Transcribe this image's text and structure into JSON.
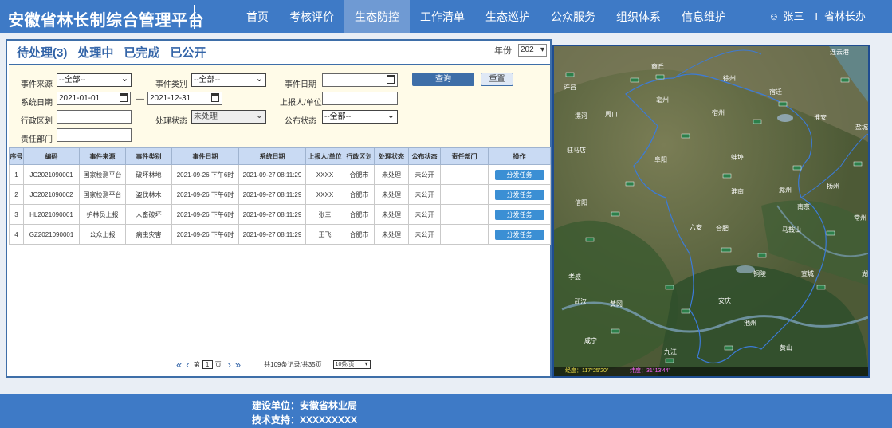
{
  "header": {
    "title": "安徽省林长制综合管理平台",
    "nav": [
      "首页",
      "考核评价",
      "生态防控",
      "工作清单",
      "生态巡护",
      "公众服务",
      "组织体系",
      "信息维护"
    ],
    "active_nav": "生态防控",
    "user": "张三",
    "role": "省林长办",
    "role_sep": "I"
  },
  "status_tabs": [
    "待处理(3)",
    "处理中",
    "已完成",
    "已公开"
  ],
  "year": {
    "label": "年份",
    "value": "202"
  },
  "filters": {
    "event_source_label": "事件来源",
    "event_source_value": "--全部--",
    "event_type_label": "事件类别",
    "event_type_value": "--全部--",
    "event_date_label": "事件日期",
    "event_date_value": "",
    "system_date_label": "系统日期",
    "system_date_start": "2021-01-01",
    "system_date_sep": "—",
    "system_date_end": "2021-12-31",
    "reporter_label": "上报人/单位",
    "reporter_value": "",
    "region_label": "行政区划",
    "region_value": "",
    "process_status_label": "处理状态",
    "process_status_value": "未处理",
    "publish_status_label": "公布状态",
    "publish_status_value": "--全部--",
    "dept_label": "责任部门",
    "dept_value": "",
    "query_button": "查询",
    "reset_button": "重置"
  },
  "table": {
    "columns": [
      "序号",
      "编码",
      "事件来源",
      "事件类别",
      "事件日期",
      "系统日期",
      "上报人/单位",
      "行政区划",
      "处理状态",
      "公布状态",
      "责任部门",
      "操作"
    ],
    "rows": [
      [
        "1",
        "JC2021090001",
        "国家检测平台",
        "破坏林地",
        "2021-09-26 下午6时",
        "2021-09-27 08:11:29",
        "XXXX",
        "合肥市",
        "未处理",
        "未公开",
        "",
        "分发任务"
      ],
      [
        "2",
        "JC2021090002",
        "国家检测平台",
        "盗伐林木",
        "2021-09-26 下午6时",
        "2021-09-27 08:11:29",
        "XXXX",
        "合肥市",
        "未处理",
        "未公开",
        "",
        "分发任务"
      ],
      [
        "3",
        "HL2021090001",
        "护林员上报",
        "人畜破坏",
        "2021-09-26 下午6时",
        "2021-09-27 08:11:29",
        "张三",
        "合肥市",
        "未处理",
        "未公开",
        "",
        "分发任务"
      ],
      [
        "4",
        "GZ2021090001",
        "公众上报",
        "病虫灾害",
        "2021-09-26 下午6时",
        "2021-09-27 08:11:29",
        "王飞",
        "合肥市",
        "未处理",
        "未公开",
        "",
        "分发任务"
      ]
    ]
  },
  "pager": {
    "page_prefix": "第",
    "page": "1",
    "page_suffix": "页",
    "info": "共109条记录/共35页",
    "page_size": "10条/页"
  },
  "map": {
    "cities": [
      "连云港",
      "商丘",
      "徐州",
      "宿迁",
      "淮安",
      "亳州",
      "宿州",
      "周口",
      "许昌",
      "漯河",
      "盐城",
      "蚌埠",
      "驻马店",
      "阜阳",
      "滁州",
      "扬州",
      "淮南",
      "南京",
      "信阳",
      "常州",
      "六安",
      "合肥",
      "马鞍山",
      "孝感",
      "铜陵",
      "宣城",
      "湖州",
      "武汉",
      "黄冈",
      "安庆",
      "池州",
      "咸宁",
      "九江",
      "黄山"
    ],
    "lng_label": "经度：",
    "lng_value": "117°25'20\"",
    "lat_label": "纬度：",
    "lat_value": "31°13'44\""
  },
  "footer": {
    "builder": "建设单位：安徽省林业局",
    "support": "技术支持：XXXXXXXXX"
  }
}
